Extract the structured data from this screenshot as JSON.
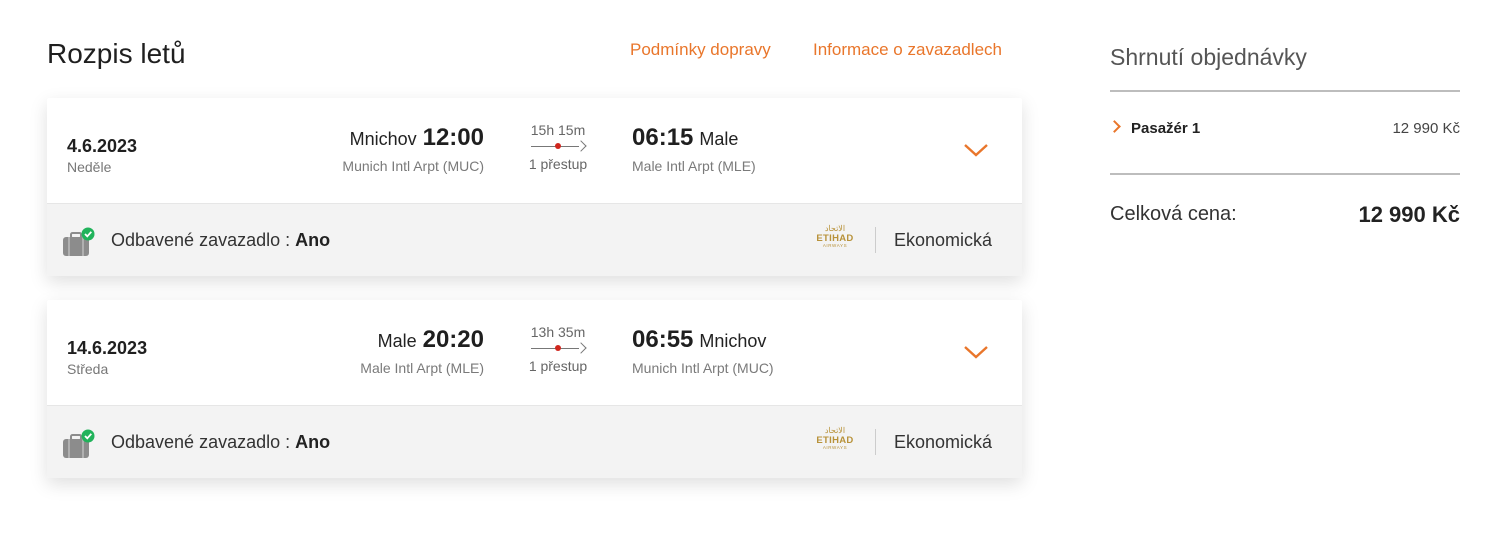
{
  "page": {
    "title": "Rozpis letů",
    "links": {
      "conditions": "Podmínky dopravy",
      "baggage": "Informace o zavazadlech"
    }
  },
  "flights": [
    {
      "date": "4.6.2023",
      "day": "Neděle",
      "departure": {
        "city": "Mnichov",
        "time": "12:00",
        "airport": "Munich Intl Arpt (MUC)"
      },
      "duration": "15h 15m",
      "stops": "1 přestup",
      "arrival": {
        "time": "06:15",
        "city": "Male",
        "airport": "Male Intl Arpt (MLE)"
      },
      "baggage_label": "Odbavené zavazadlo :",
      "baggage_value": "Ano",
      "airline": "ETIHAD AIRWAYS",
      "cabin": "Ekonomická"
    },
    {
      "date": "14.6.2023",
      "day": "Středa",
      "departure": {
        "city": "Male",
        "time": "20:20",
        "airport": "Male Intl Arpt (MLE)"
      },
      "duration": "13h 35m",
      "stops": "1 přestup",
      "arrival": {
        "time": "06:55",
        "city": "Mnichov",
        "airport": "Munich Intl Arpt (MUC)"
      },
      "baggage_label": "Odbavené zavazadlo :",
      "baggage_value": "Ano",
      "airline": "ETIHAD AIRWAYS",
      "cabin": "Ekonomická"
    }
  ],
  "summary": {
    "title": "Shrnutí objednávky",
    "passenger_label": "Pasažér 1",
    "passenger_price": "12 990 Kč",
    "total_label": "Celková cena:",
    "total_price": "12 990 Kč"
  },
  "icons": {
    "expand": "chevron-down-icon",
    "baggage": "suitcase-check-icon",
    "passenger": "chevron-right-icon"
  },
  "colors": {
    "accent": "#e9762b",
    "stop_dot": "#d0261d",
    "check": "#21b35b",
    "airline_gold": "#b8923a"
  }
}
